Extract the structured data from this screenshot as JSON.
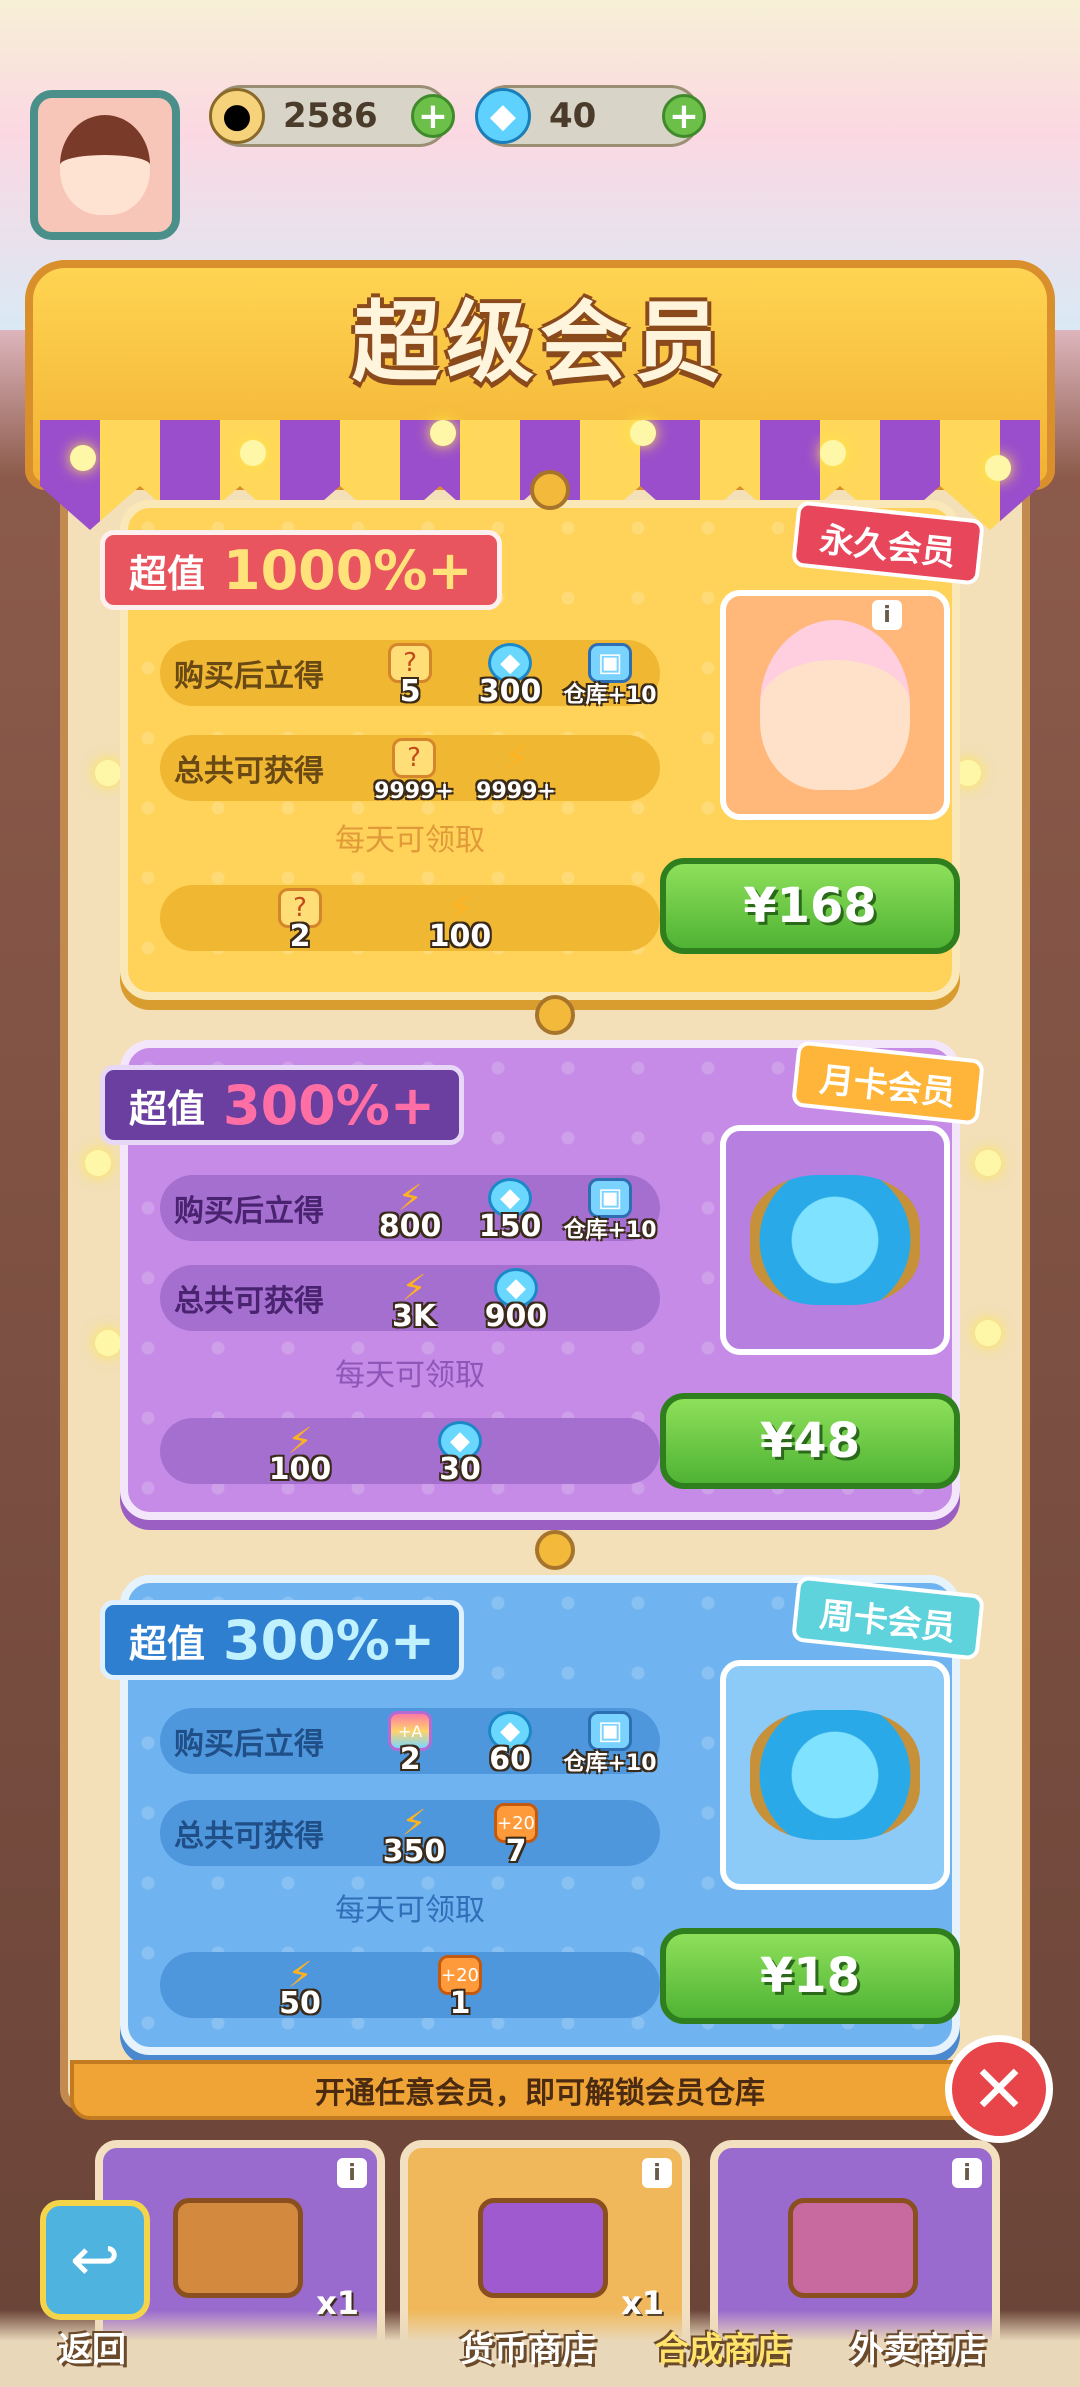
{
  "header": {
    "coins": "2586",
    "gems": "40",
    "coin_icon": "seed-coin-icon",
    "gem_icon": "diamond-icon"
  },
  "title": "超级会员",
  "cards": [
    {
      "badge_label": "超值",
      "badge_value": "1000%+",
      "tag": "永久会员",
      "row1_label": "购买后立得",
      "row1_items": [
        "5",
        "300",
        "仓库+10"
      ],
      "row2_label": "总共可获得",
      "row2_items": [
        "9999+",
        "9999+"
      ],
      "daily_label": "每天可领取",
      "daily_items": [
        "2",
        "100"
      ],
      "price": "¥168"
    },
    {
      "badge_label": "超值",
      "badge_value": "300%+",
      "tag": "月卡会员",
      "row1_label": "购买后立得",
      "row1_items": [
        "800",
        "150",
        "仓库+10"
      ],
      "row2_label": "总共可获得",
      "row2_items": [
        "3K",
        "900"
      ],
      "daily_label": "每天可领取",
      "daily_items": [
        "100",
        "30"
      ],
      "price": "¥48"
    },
    {
      "badge_label": "超值",
      "badge_value": "300%+",
      "tag": "周卡会员",
      "row1_label": "购买后立得",
      "row1_items": [
        "2",
        "60",
        "仓库+10"
      ],
      "row2_label": "总共可获得",
      "row2_items": [
        "350",
        "7"
      ],
      "daily_label": "每天可领取",
      "daily_items": [
        "50",
        "1"
      ],
      "price": "¥18"
    }
  ],
  "footer_note": "开通任意会员，即可解锁会员仓库",
  "shop_tiles": [
    {
      "qty": "x1"
    },
    {
      "qty": "x1"
    },
    {
      "qty": ""
    }
  ],
  "nav": {
    "back": "返回",
    "currency_shop": "货币商店",
    "merge_shop": "合成商店",
    "delivery_shop": "外卖商店"
  },
  "colors": {
    "gold_card": "#ffd35a",
    "purple_card": "#c58be6",
    "blue_card": "#6fb4f0",
    "buy_button": "#4fb334",
    "close_button": "#e8454a"
  }
}
